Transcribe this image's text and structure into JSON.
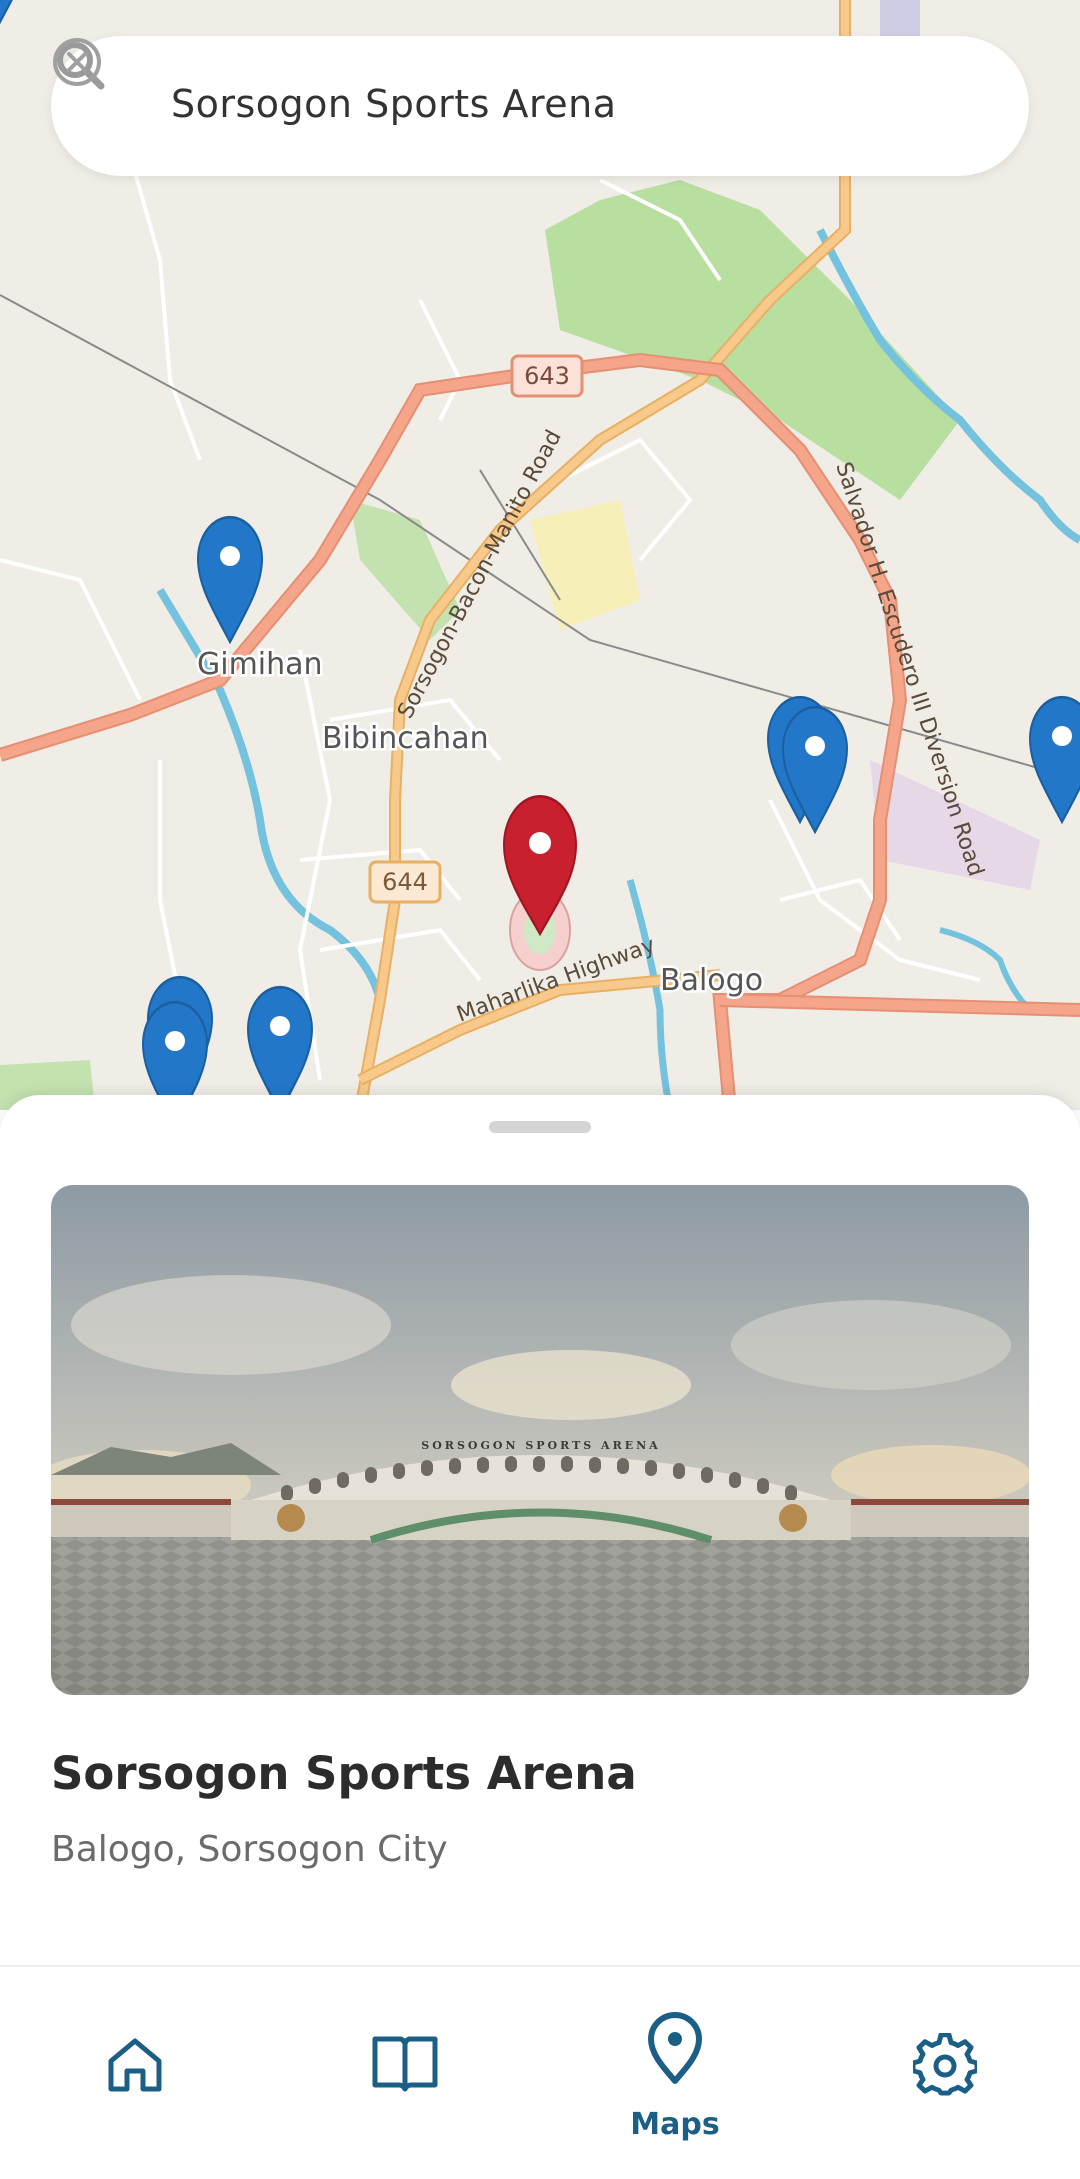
{
  "search": {
    "query": "Sorsogon Sports Arena"
  },
  "map": {
    "labels": {
      "gimihan": "Gimihan",
      "bibincahan": "Bibincahan",
      "balogo": "Balogo",
      "road_643": "643",
      "road_644": "644",
      "sorsogon_bacon_manito": "Sorsogon-Bacon-Manito Road",
      "salvador_escudero": "Salvador H. Escudero III Diversion Road",
      "maharlika": "Maharlika Highway"
    },
    "colors": {
      "land": "#f0ede6",
      "primary_road": "#f4a58a",
      "secondary_road": "#f7c98b",
      "park": "#b8dea0",
      "water": "#74c2de",
      "marker_blue": "#2377c9",
      "marker_red": "#c8202e"
    }
  },
  "place": {
    "name": "Sorsogon Sports Arena",
    "address": "Balogo, Sorsogon City",
    "photo_sign": "SORSOGON SPORTS ARENA"
  },
  "nav": {
    "active_label": "Maps",
    "accent": "#1b5f86",
    "items": [
      {
        "icon": "home-icon"
      },
      {
        "icon": "book-icon"
      },
      {
        "icon": "map-pin-icon",
        "label": "Maps"
      },
      {
        "icon": "gear-icon"
      }
    ]
  }
}
